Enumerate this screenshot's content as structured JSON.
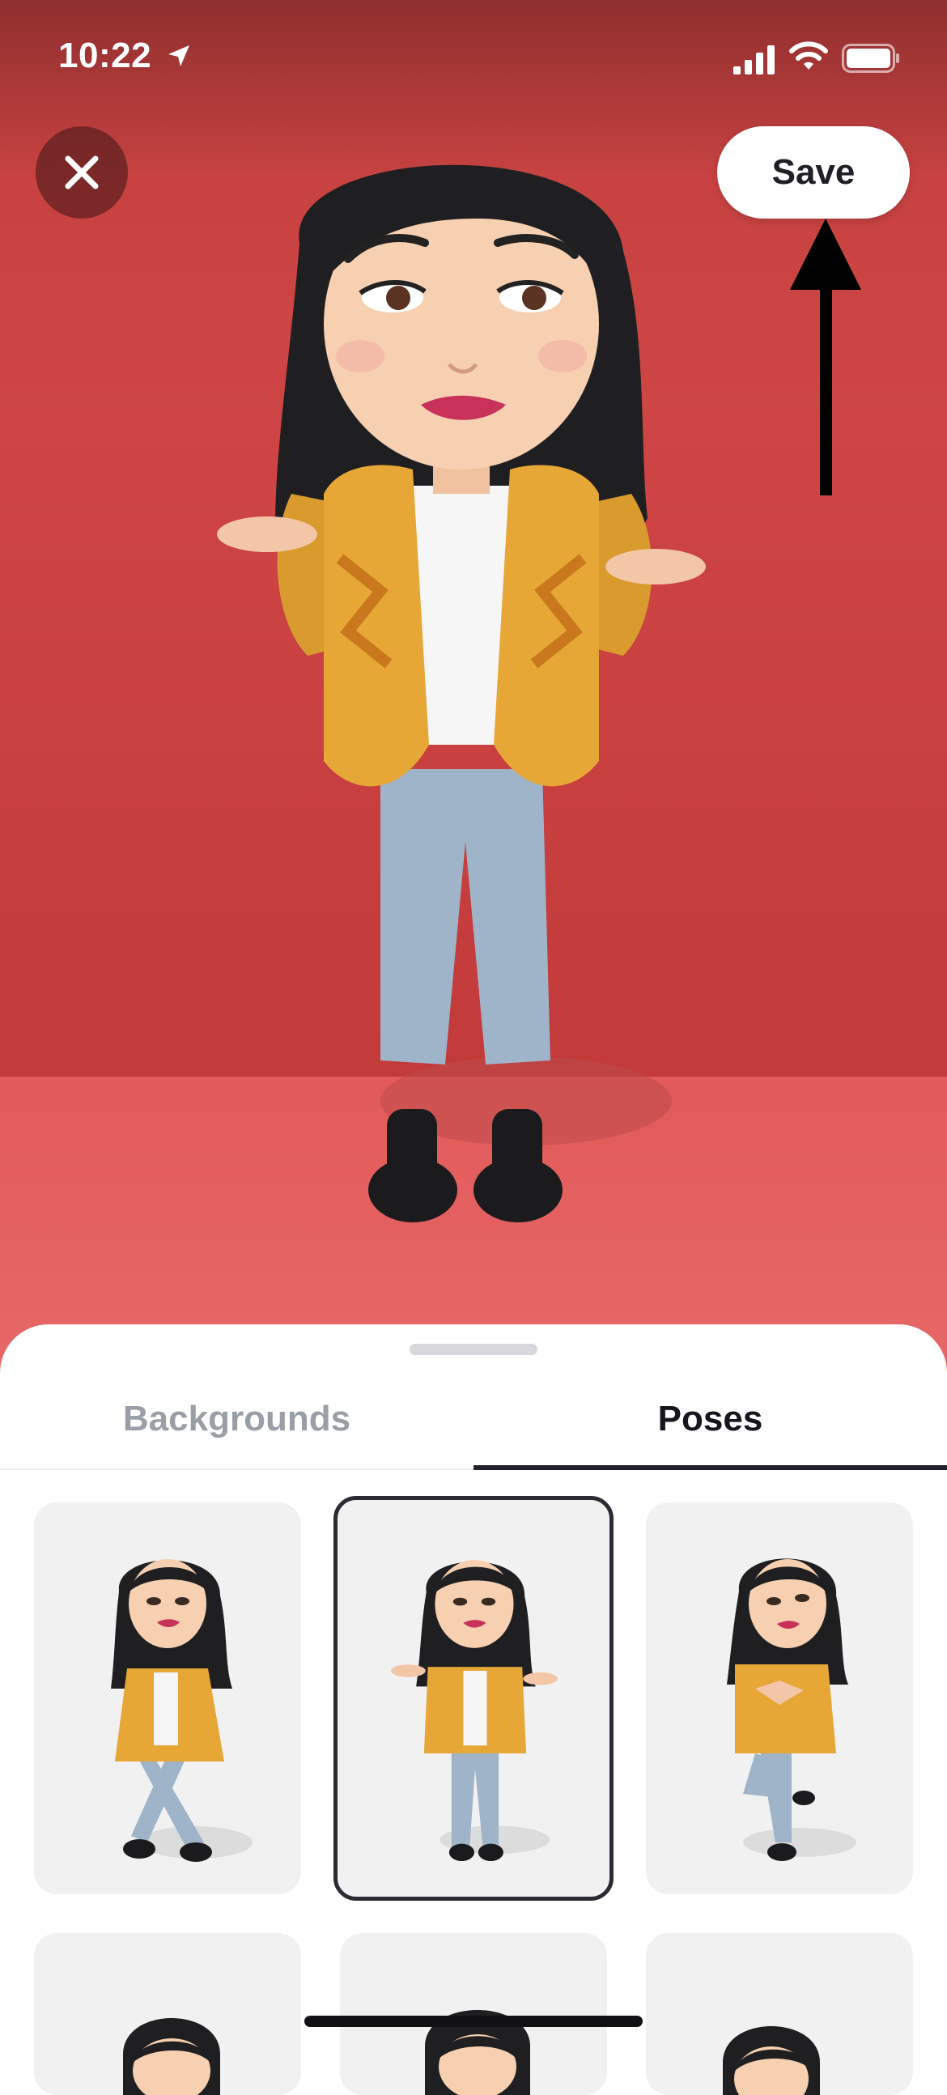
{
  "status_bar": {
    "time": "10:22"
  },
  "top_controls": {
    "save_label": "Save"
  },
  "tabs": [
    {
      "label": "Backgrounds",
      "selected": false
    },
    {
      "label": "Poses",
      "selected": true
    }
  ],
  "poses": {
    "selected_index": 1,
    "items": [
      {
        "name": "crossed-legs-pose"
      },
      {
        "name": "shrug-pose"
      },
      {
        "name": "heart-hands-pose"
      },
      {
        "name": "pose-4"
      },
      {
        "name": "pose-5"
      },
      {
        "name": "pose-6"
      }
    ]
  },
  "colors": {
    "background_red": "#cf4545",
    "floor_red": "#e76868",
    "jacket_yellow": "#e6a736",
    "jeans_blue": "#9fb4c8",
    "hair_black": "#1f1f22"
  }
}
